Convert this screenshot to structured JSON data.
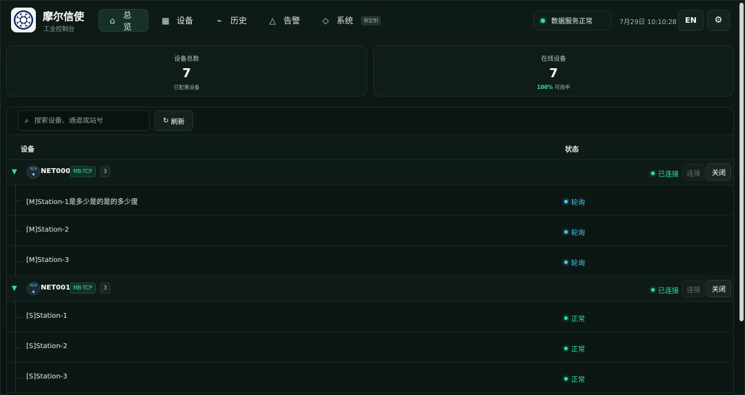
{
  "app": {
    "title": "摩尔信使",
    "subtitle": "工业控制台"
  },
  "nav": [
    {
      "label": "总览",
      "icon": "home-icon",
      "glyph": "⌂",
      "active": true
    },
    {
      "label": "设备",
      "icon": "grid-icon",
      "glyph": "▦",
      "active": false
    },
    {
      "label": "历史",
      "icon": "trend-icon",
      "glyph": "⌁",
      "active": false
    },
    {
      "label": "告警",
      "icon": "alert-triangle-icon",
      "glyph": "△",
      "active": false
    },
    {
      "label": "系统",
      "icon": "diamond-icon",
      "glyph": "◇",
      "active": false,
      "badge": "需定制"
    }
  ],
  "header": {
    "service_status": "数据服务正常",
    "datetime": "7月29日 10:10:28",
    "lang_button": "EN",
    "settings_glyph": "⚙"
  },
  "stats": [
    {
      "label": "设备总数",
      "value": "7",
      "sub": "已配置设备"
    },
    {
      "label": "在线设备",
      "value": "7",
      "sub_accent": "100%",
      "sub": " 可用率"
    }
  ],
  "toolbar": {
    "search_placeholder": "搜索设备、通道或站号",
    "search_glyph": "⌕",
    "refresh_label": "刷新",
    "refresh_glyph": "↻"
  },
  "table": {
    "col_device": "设备",
    "col_status": "状态"
  },
  "groups": [
    {
      "name": "NET000",
      "tcp_top": "TCP",
      "tcp_arrow": "▼",
      "protocol": "MB-TCP",
      "count": "3",
      "conn_status": "已连接",
      "connect_label": "连接",
      "close_label": "关闭",
      "stations": [
        {
          "name": "[M]Station-1是多少是的是的多少度",
          "status": "轮询",
          "kind": "poll"
        },
        {
          "name": "[M]Station-2",
          "status": "轮询",
          "kind": "poll"
        },
        {
          "name": "[M]Station-3",
          "status": "轮询",
          "kind": "poll"
        }
      ]
    },
    {
      "name": "NET001",
      "tcp_top": "TCP",
      "tcp_arrow": "▲",
      "protocol": "MB-TCP",
      "count": "3",
      "conn_status": "已连接",
      "connect_label": "连接",
      "close_label": "关闭",
      "stations": [
        {
          "name": "[S]Station-1",
          "status": "正常",
          "kind": "ok"
        },
        {
          "name": "[S]Station-2",
          "status": "正常",
          "kind": "ok"
        },
        {
          "name": "[S]Station-3",
          "status": "正常",
          "kind": "ok"
        }
      ]
    }
  ],
  "colors": {
    "accent": "#2ee59d",
    "poll": "#4cc8f0",
    "background": "#0b1613"
  }
}
